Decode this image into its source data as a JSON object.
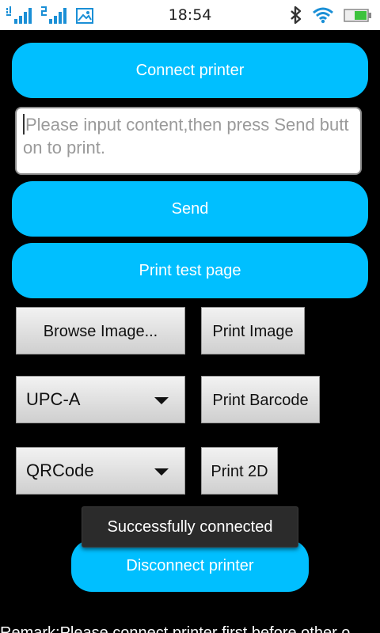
{
  "status_bar": {
    "time": "18:54",
    "left_icons": [
      "signal-sim1-icon",
      "signal-sim2-icon",
      "image-notification-icon"
    ],
    "right_icons": [
      "bluetooth-icon",
      "wifi-icon",
      "battery-icon"
    ]
  },
  "buttons": {
    "connect": "Connect printer",
    "send": "Send",
    "print_test_page": "Print test page",
    "browse_image": "Browse Image...",
    "print_image": "Print Image",
    "print_barcode": "Print Barcode",
    "print_2d": "Print 2D",
    "disconnect": "Disconnect printer"
  },
  "input": {
    "placeholder": "Please input content,then press Send button to print."
  },
  "spinners": {
    "barcode_type": "UPC-A",
    "code_2d_type": "QRCode"
  },
  "toast": "Successfully connected",
  "remark": "Remark:Please connect printer first before other o",
  "colors": {
    "accent": "#00bfff",
    "background": "#000000"
  }
}
